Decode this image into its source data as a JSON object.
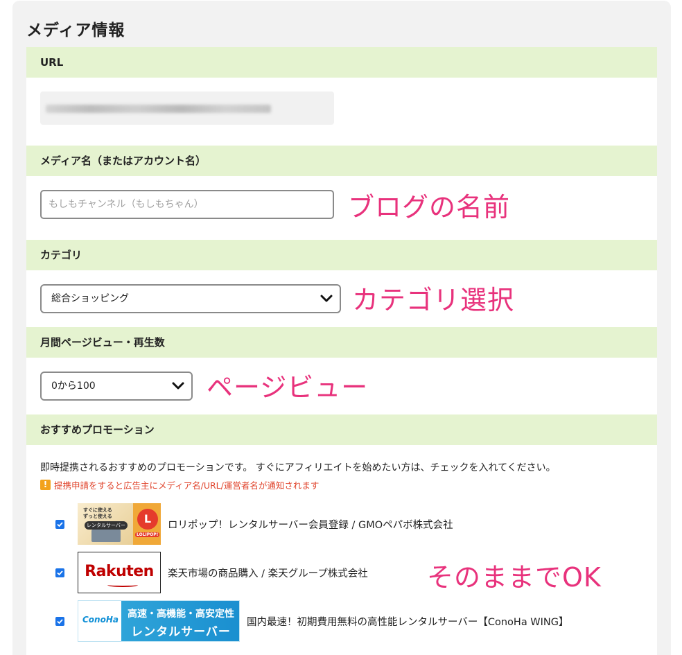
{
  "panel": {
    "title": "メディア情報"
  },
  "sections": {
    "url": {
      "label": "URL",
      "value_obscured": true
    },
    "media_name": {
      "label": "メディア名（またはアカウント名）",
      "placeholder": "もしもチャンネル（もしもちゃん）",
      "value": "",
      "annotation": "ブログの名前"
    },
    "category": {
      "label": "カテゴリ",
      "selected": "総合ショッピング",
      "annotation": "カテゴリ選択"
    },
    "pageviews": {
      "label": "月間ページビュー・再生数",
      "selected": "0から100",
      "annotation": "ページビュー"
    },
    "promotion": {
      "label": "おすすめプロモーション",
      "intro": "即時提携されるおすすめのプロモーションです。 すぐにアフィリエイトを始めたい方は、チェックを入れてください。",
      "warning": "提携申請をすると広告主にメディア名/URL/運営者名が通知されます",
      "annotation": "そのままでOK",
      "items": [
        {
          "label": "ロリポップ！レンタルサーバー会員登録 / GMOペパボ株式会社",
          "checked": true,
          "thumb": {
            "line1": "すぐに使える",
            "line2": "ずっと使える",
            "line3": "レンタルサーバー",
            "logo_text": "LOLIPOP!"
          }
        },
        {
          "label": "楽天市場の商品購入 / 楽天グループ株式会社",
          "checked": true,
          "thumb": {
            "brand": "Rakuten"
          }
        },
        {
          "label": "国内最速！初期費用無料の高性能レンタルサーバー【ConoHa WING】",
          "checked": true,
          "thumb": {
            "logo": "ConoHa",
            "line1": "高速・高機能・高安定性",
            "line2": "レンタルサーバー"
          }
        }
      ]
    }
  },
  "colors": {
    "section_header_bg": "#e5f3d0",
    "panel_bg": "#f2f2f2",
    "annotation": "#e8327c",
    "warning_text": "#e0442c",
    "checkbox": "#1a73e8"
  }
}
